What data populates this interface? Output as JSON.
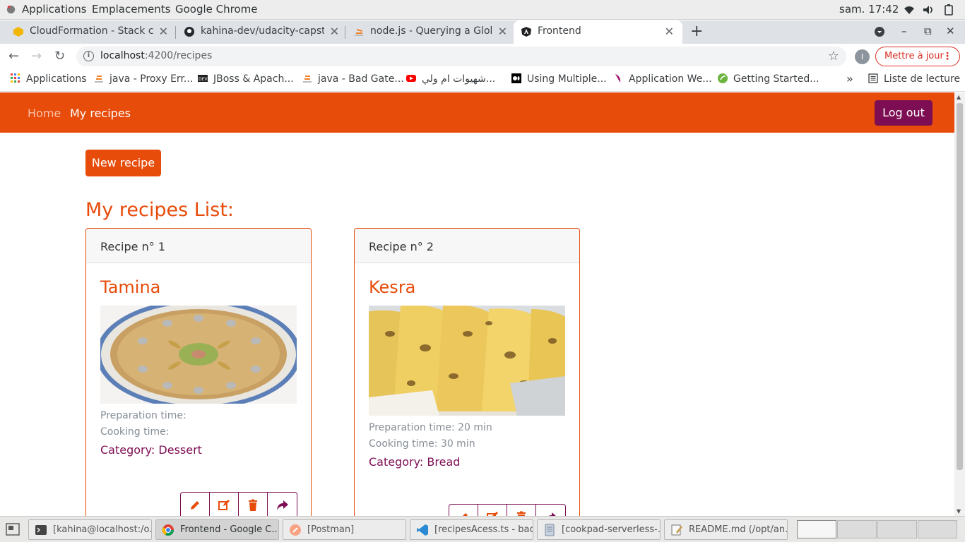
{
  "gnome": {
    "applications": "Applications",
    "places": "Emplacements",
    "app": "Google Chrome",
    "clock": "sam. 17:42"
  },
  "tabs": [
    {
      "title": "CloudFormation - Stack co",
      "icon": "aws-icon"
    },
    {
      "title": "kahina-dev/udacity-capston",
      "icon": "github-icon"
    },
    {
      "title": "node.js - Querying a Globa",
      "icon": "stackoverflow-icon"
    },
    {
      "title": "Frontend",
      "icon": "angular-icon",
      "active": true
    }
  ],
  "toolbar": {
    "url_host": "localhost",
    "url_rest": ":4200/recipes",
    "profile_initial": "I",
    "update_label": "Mettre à jour"
  },
  "bookmarks": [
    {
      "label": "Applications",
      "icon": "apps-grid-icon"
    },
    {
      "label": "java - Proxy Err...",
      "icon": "stackoverflow-icon"
    },
    {
      "label": "JBoss & Apach...",
      "icon": "dev-icon"
    },
    {
      "label": "java - Bad Gate...",
      "icon": "stackoverflow-icon"
    },
    {
      "label": "شهيوات ام ولي...",
      "icon": "youtube-icon"
    },
    {
      "label": "Using Multiple...",
      "icon": "medium-icon"
    },
    {
      "label": "Application We...",
      "icon": "bookmark-icon"
    },
    {
      "label": "Getting Started...",
      "icon": "spring-icon"
    }
  ],
  "reading_list": "Liste de lecture",
  "navbar": {
    "home": "Home",
    "my_recipes": "My recipes",
    "logout": "Log out"
  },
  "page": {
    "new_recipe": "New recipe",
    "list_title": "My recipes List:"
  },
  "recipes": [
    {
      "header": "Recipe n° 1",
      "name": "Tamina",
      "prep": "Preparation time:",
      "cook": "Cooking time:",
      "category": "Category: Dessert"
    },
    {
      "header": "Recipe n° 2",
      "name": "Kesra",
      "prep": "Preparation time: 20 min",
      "cook": "Cooking time: 30 min",
      "category": "Category: Bread"
    }
  ],
  "taskbar": [
    {
      "label": "[kahina@localhost:/o...",
      "icon": "terminal-icon"
    },
    {
      "label": "Frontend - Google C...",
      "icon": "chrome-icon",
      "active": true
    },
    {
      "label": "[Postman]",
      "icon": "postman-icon"
    },
    {
      "label": "[recipesAcess.ts - bac...",
      "icon": "vscode-icon"
    },
    {
      "label": "[cookpad-serverless-...",
      "icon": "files-icon"
    },
    {
      "label": "README.md (/opt/an...",
      "icon": "text-editor-icon"
    }
  ],
  "colors": {
    "brand_orange": "#e74c0b",
    "brand_purple": "#7d0e53"
  }
}
